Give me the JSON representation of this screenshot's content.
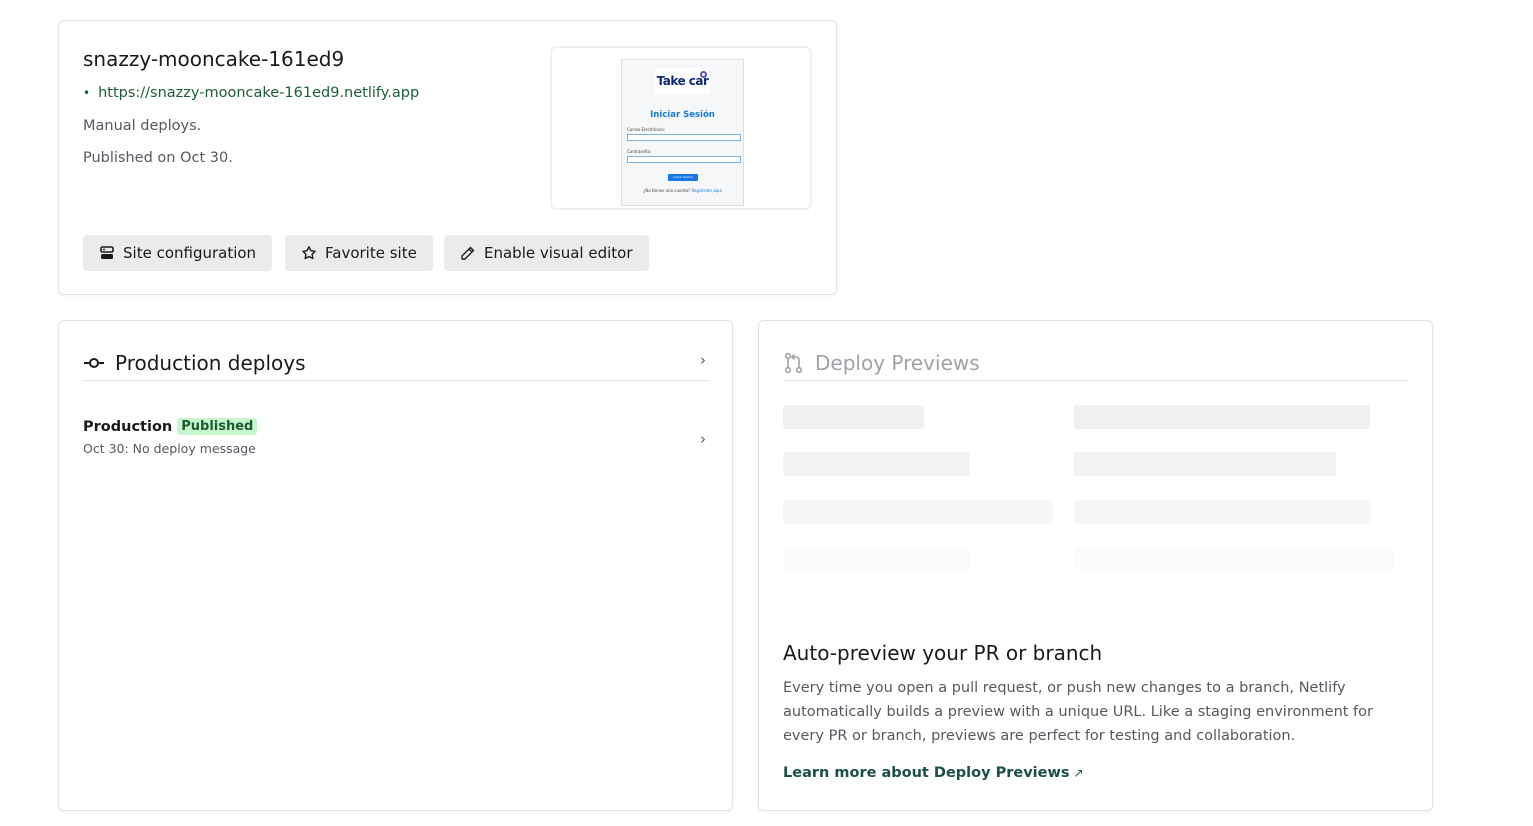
{
  "site": {
    "name": "snazzy-mooncake-161ed9",
    "url": "https://snazzy-mooncake-161ed9.netlify.app",
    "deploy_mode": "Manual deploys.",
    "published": "Published on Oct 30.",
    "thumbnail": {
      "logo_text": "Take car",
      "title": "Iniciar Sesión",
      "email_label": "Correo Electrónico:",
      "password_label": "Contraseña:",
      "button_label": "Iniciar Sesión",
      "footer_text": "¿No tienes una cuenta?",
      "footer_link": "Regístrate aquí"
    }
  },
  "actions": {
    "config_label": "Site configuration",
    "favorite_label": "Favorite site",
    "editor_label": "Enable visual editor"
  },
  "production": {
    "title": "Production deploys",
    "row_label": "Production",
    "badge": "Published",
    "message": "Oct 30: No deploy message"
  },
  "previews": {
    "title": "Deploy Previews",
    "heading": "Auto-preview your PR or branch",
    "body": "Every time you open a pull request, or push new changes to a branch, Netlify automatically builds a preview with a unique URL. Like a staging environment for every PR or branch, previews are perfect for testing and collaboration.",
    "link": "Learn more about Deploy Previews",
    "link_arrow": "↗"
  },
  "icons": {
    "chevron": "›",
    "bullet": "•"
  },
  "colors": {
    "link_green": "#1b5e38",
    "badge_bg": "#c6f5cf",
    "button_bg": "#e9ebed"
  }
}
